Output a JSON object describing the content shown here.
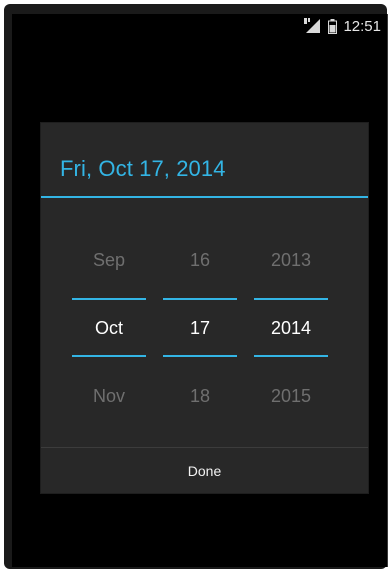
{
  "status_bar": {
    "time": "12:51",
    "signal_icon": "signal-icon",
    "battery_icon": "battery-icon"
  },
  "dialog": {
    "title": "Fri, Oct 17, 2014",
    "accent_color": "#33b5e5",
    "month": {
      "prev": "Sep",
      "current": "Oct",
      "next": "Nov"
    },
    "day": {
      "prev": "16",
      "current": "17",
      "next": "18"
    },
    "year": {
      "prev": "2013",
      "current": "2014",
      "next": "2015"
    },
    "done_label": "Done"
  }
}
